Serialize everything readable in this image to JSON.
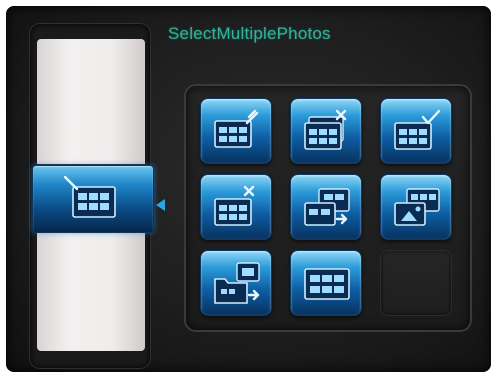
{
  "screen": {
    "title": "SelectMultiplePhotos"
  },
  "filmstrip": {
    "selected_item": {
      "icon": "thumbnail-grid-edit-icon"
    },
    "pointer_icon": "triangle-left-icon"
  },
  "grid": {
    "tiles": [
      {
        "icon": "select-multiple-edit-icon"
      },
      {
        "icon": "delete-multiple-icon"
      },
      {
        "icon": "select-all-check-icon"
      },
      {
        "icon": "delete-all-icon"
      },
      {
        "icon": "copy-photos-icon"
      },
      {
        "icon": "slideshow-photos-icon"
      },
      {
        "icon": "folder-copy-icon"
      },
      {
        "icon": "thumbnail-view-icon"
      },
      {
        "icon": "empty-slot"
      }
    ]
  },
  "colors": {
    "title_text": "#2eb39a",
    "tile_blue": "#1f86c8",
    "pointer": "#28a6e4",
    "background": "#1d1d1d"
  }
}
